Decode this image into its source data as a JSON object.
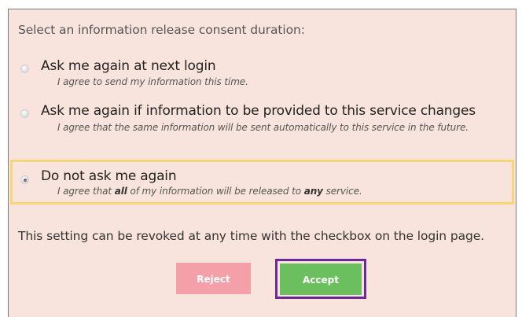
{
  "consent": {
    "heading": "Select an information release consent duration:",
    "options": [
      {
        "label": "Ask me again at next login",
        "description": "I agree to send my information this time.",
        "selected": false
      },
      {
        "label": "Ask me again if information to be provided to this service changes",
        "description": "I agree that the same information will be sent automatically to this service in the future.",
        "selected": false
      },
      {
        "label": "Do not ask me again",
        "description_parts": [
          "I agree that ",
          "all",
          " of my information will be released to ",
          "any",
          " service."
        ],
        "selected": true
      }
    ],
    "footer_note": "This setting can be revoked at any time with the checkbox on the login page.",
    "reject_label": "Reject",
    "accept_label": "Accept"
  },
  "colors": {
    "panel_background": "#f9e4dd",
    "selected_highlight": "#f7d774",
    "reject_button": "#f4a0a8",
    "accept_button": "#6cbf5e",
    "accept_focus_frame": "#6b2a97"
  }
}
